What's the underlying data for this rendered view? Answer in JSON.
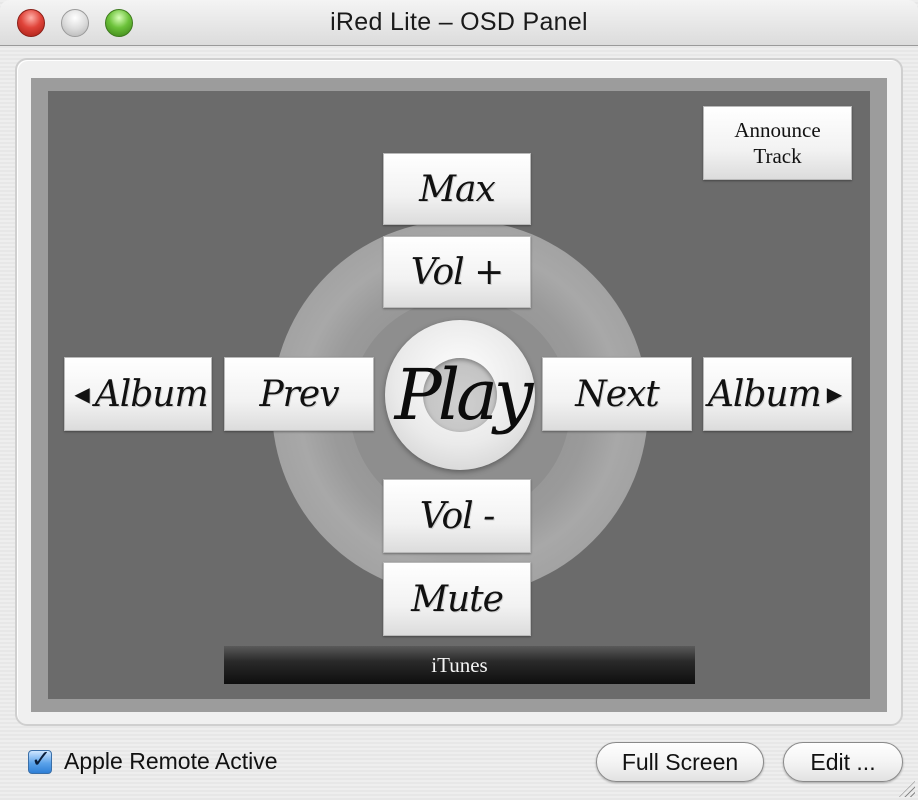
{
  "window": {
    "title": "iRed Lite – OSD Panel",
    "controls": [
      "close",
      "minimize",
      "zoom"
    ]
  },
  "osd": {
    "announce_button": {
      "line1": "Announce",
      "line2": "Track"
    },
    "buttons": {
      "max": "Max",
      "vol_up": "Vol +",
      "play": "Play",
      "prev": "Prev",
      "next": "Next",
      "album_prev": "Album",
      "album_next": "Album",
      "vol_down": "Vol -",
      "mute": "Mute"
    },
    "icons": {
      "album_prev": "◀",
      "album_next": "▶"
    },
    "target_app": "iTunes"
  },
  "footer": {
    "checkbox": {
      "label": "Apple Remote Active",
      "checked": true
    },
    "full_screen_button": "Full Screen",
    "edit_button": "Edit ..."
  }
}
